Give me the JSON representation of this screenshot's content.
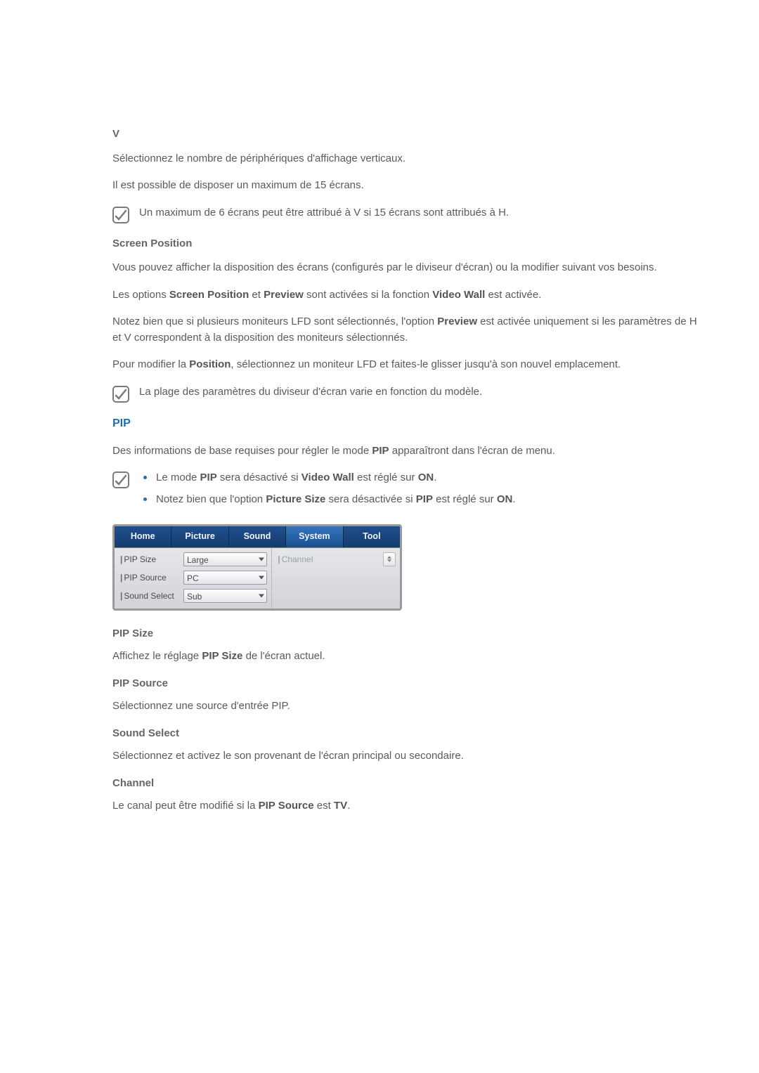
{
  "v": {
    "heading": "V",
    "para1": "Sélectionnez le nombre de périphériques d'affichage verticaux.",
    "para2": "Il est possible de disposer un maximum de 15 écrans.",
    "note": "Un maximum de 6 écrans peut être attribué à V si 15 écrans sont attribués à H."
  },
  "screen_position": {
    "heading": "Screen Position",
    "para1": "Vous pouvez afficher la disposition des écrans (configurés par le diviseur d'écran) ou la modifier suivant vos besoins.",
    "para2_pre": "Les options ",
    "para2_b1": "Screen Position",
    "para2_mid1": " et ",
    "para2_b2": "Preview",
    "para2_mid2": " sont activées si la fonction ",
    "para2_b3": "Video Wall",
    "para2_post": " est activée.",
    "para3_pre": "Notez bien que si plusieurs moniteurs LFD sont sélectionnés, l'option ",
    "para3_b1": "Preview",
    "para3_post": " est activée uniquement si les paramètres de H et V correspondent à la disposition des moniteurs sélectionnés.",
    "para4_pre": "Pour modifier la ",
    "para4_b1": "Position",
    "para4_post": ", sélectionnez un moniteur LFD et faites-le glisser jusqu'à son nouvel emplacement.",
    "note": "La plage des paramètres du diviseur d'écran varie en fonction du modèle."
  },
  "pip": {
    "heading": "PIP",
    "intro_pre": "Des informations de base requises pour régler le mode ",
    "intro_b1": "PIP",
    "intro_post": " apparaîtront dans l'écran de menu.",
    "bullet1_pre": "Le mode ",
    "bullet1_b1": "PIP",
    "bullet1_mid1": " sera désactivé si ",
    "bullet1_b2": "Video Wall",
    "bullet1_mid2": " est réglé sur ",
    "bullet1_b3": "ON",
    "bullet1_post": ".",
    "bullet2_pre": "Notez bien que l'option ",
    "bullet2_b1": "Picture Size",
    "bullet2_mid1": " sera désactivée si ",
    "bullet2_b2": "PIP",
    "bullet2_mid2": " est réglé sur ",
    "bullet2_b3": "ON",
    "bullet2_post": "."
  },
  "ui_panel": {
    "tabs": {
      "home": "Home",
      "picture": "Picture",
      "sound": "Sound",
      "system": "System",
      "tool": "Tool"
    },
    "rows": {
      "pip_size": {
        "label": "PIP Size",
        "value": "Large"
      },
      "pip_source": {
        "label": "PIP Source",
        "value": "PC"
      },
      "sound_select": {
        "label": "Sound Select",
        "value": "Sub"
      }
    },
    "right": {
      "channel_label": "Channel"
    }
  },
  "pip_size": {
    "heading": "PIP Size",
    "para_pre": "Affichez le réglage ",
    "para_b1": "PIP Size",
    "para_post": " de l'écran actuel."
  },
  "pip_source": {
    "heading": "PIP Source",
    "para": "Sélectionnez une source d'entrée PIP."
  },
  "sound_select": {
    "heading": "Sound Select",
    "para": "Sélectionnez et activez le son provenant de l'écran principal ou secondaire."
  },
  "channel": {
    "heading": "Channel",
    "para_pre": "Le canal peut être modifié si la ",
    "para_b1": "PIP Source",
    "para_mid": " est ",
    "para_b2": "TV",
    "para_post": "."
  }
}
